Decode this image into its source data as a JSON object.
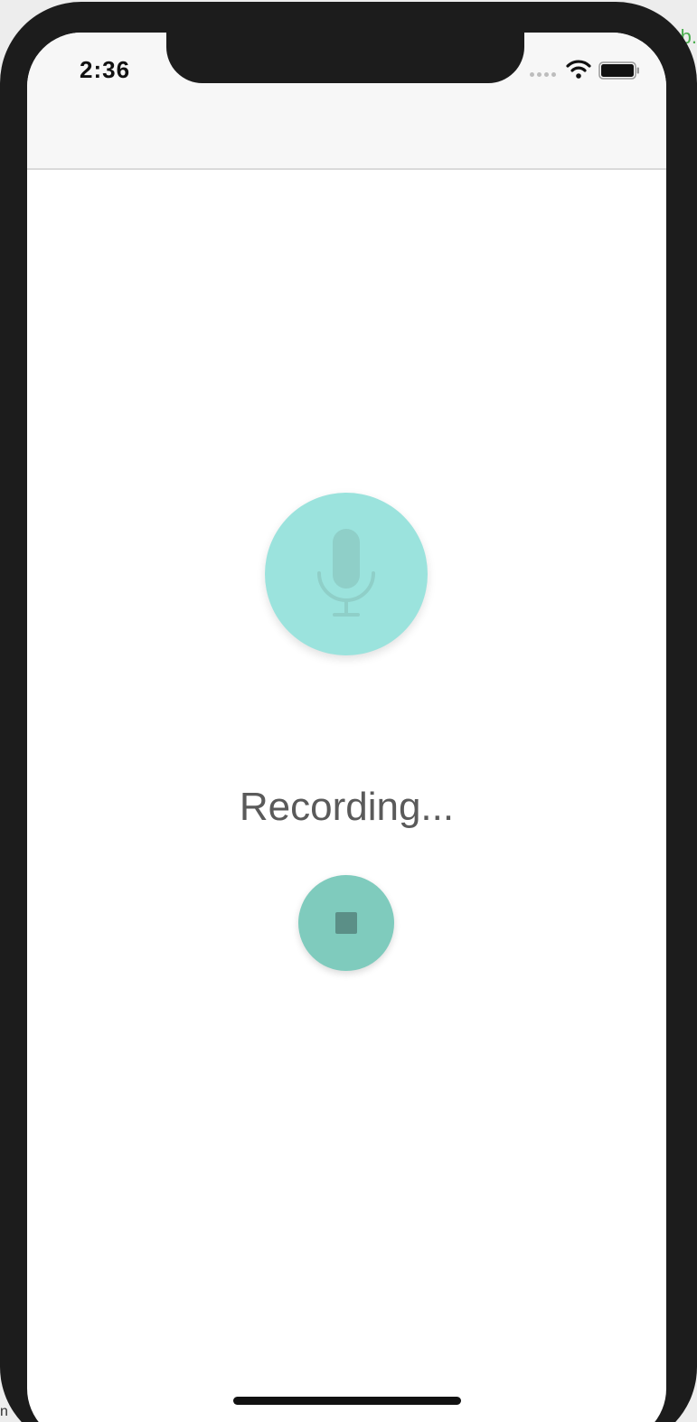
{
  "status_bar": {
    "time": "2:36",
    "icons": [
      "signal-dots-icon",
      "wifi-icon",
      "battery-icon"
    ]
  },
  "screen": {
    "status_label": "Recording...",
    "mic_button_icon": "microphone-icon",
    "stop_button_icon": "stop-icon"
  },
  "colors": {
    "mic_button": "#9be3dd",
    "stop_button": "#7fcbbd",
    "status_text": "#5a5a5a"
  }
}
